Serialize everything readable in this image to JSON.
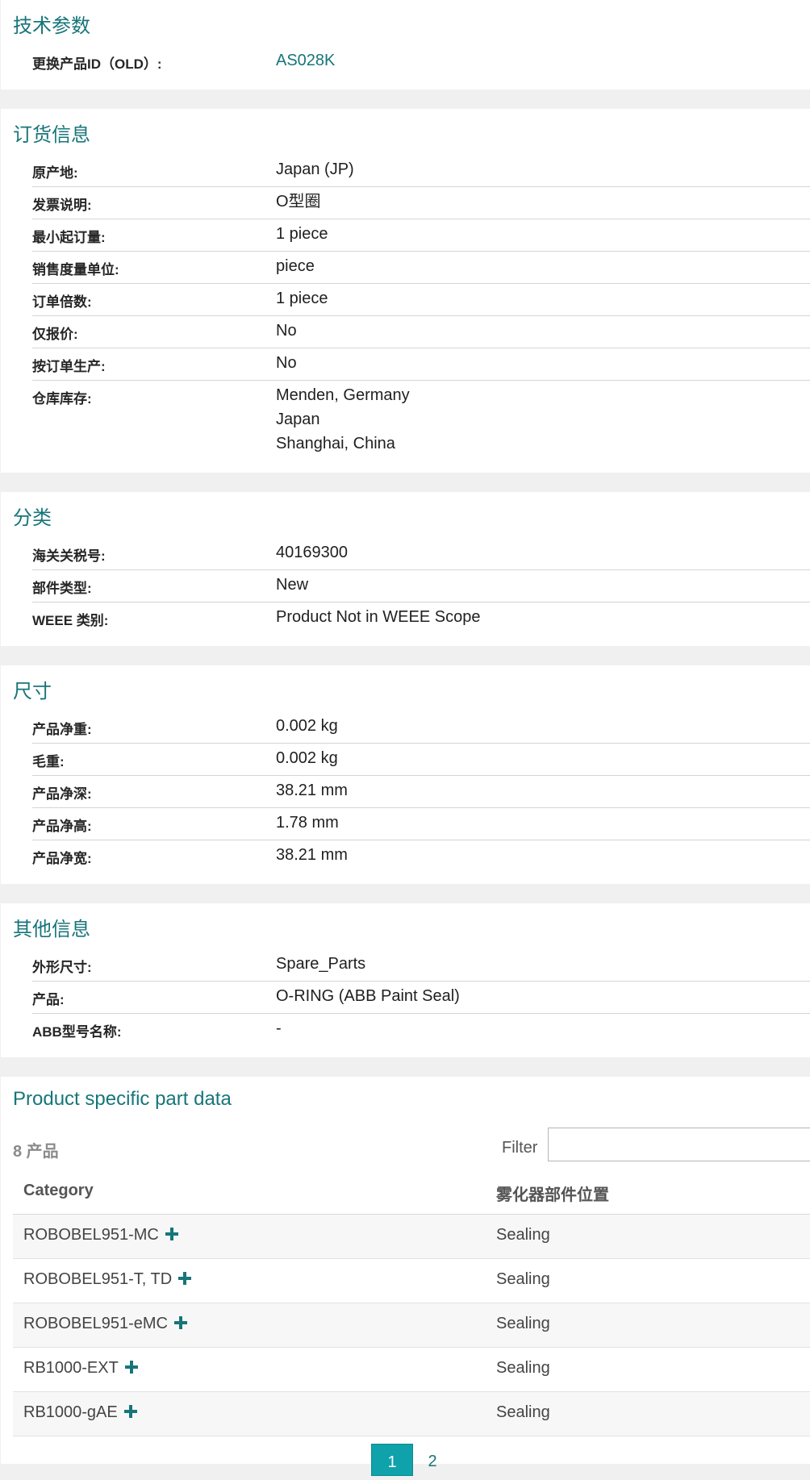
{
  "sections": {
    "tech": {
      "title": "技术参数",
      "rows": [
        {
          "label": "更换产品ID（OLD）:",
          "value": "AS028K"
        }
      ]
    },
    "order": {
      "title": "订货信息",
      "rows": [
        {
          "label": "原产地:",
          "value": "Japan (JP)"
        },
        {
          "label": "发票说明:",
          "value": "O型圈"
        },
        {
          "label": "最小起订量:",
          "value": "1 piece"
        },
        {
          "label": "销售度量单位:",
          "value": "piece"
        },
        {
          "label": "订单倍数:",
          "value": "1 piece"
        },
        {
          "label": "仅报价:",
          "value": "No"
        },
        {
          "label": "按订单生产:",
          "value": "No"
        },
        {
          "label": "仓库库存:",
          "values": [
            "Menden, Germany",
            "Japan",
            "Shanghai, China"
          ]
        }
      ]
    },
    "classification": {
      "title": "分类",
      "rows": [
        {
          "label": "海关关税号:",
          "value": "40169300"
        },
        {
          "label": "部件类型:",
          "value": "New"
        },
        {
          "label": "WEEE 类别:",
          "value": "Product Not in WEEE Scope"
        }
      ]
    },
    "dimensions": {
      "title": "尺寸",
      "rows": [
        {
          "label": "产品净重:",
          "value": "0.002 kg"
        },
        {
          "label": "毛重:",
          "value": "0.002 kg"
        },
        {
          "label": "产品净深:",
          "value": "38.21 mm"
        },
        {
          "label": "产品净高:",
          "value": "1.78 mm"
        },
        {
          "label": "产品净宽:",
          "value": "38.21 mm"
        }
      ]
    },
    "other": {
      "title": "其他信息",
      "rows": [
        {
          "label": "外形尺寸:",
          "value": "Spare_Parts"
        },
        {
          "label": "产品:",
          "value": "O-RING (ABB Paint Seal)"
        },
        {
          "label": "ABB型号名称:",
          "value": "-"
        }
      ]
    }
  },
  "part_data": {
    "title": "Product specific part data",
    "count_label": "8 产品",
    "filter_label": "Filter",
    "filter_value": "",
    "columns": [
      "Category",
      "雾化器部件位置"
    ],
    "rows": [
      {
        "category": "ROBOBEL951-MC",
        "position": "Sealing"
      },
      {
        "category": "ROBOBEL951-T, TD",
        "position": "Sealing"
      },
      {
        "category": "ROBOBEL951-eMC",
        "position": "Sealing"
      },
      {
        "category": "RB1000-EXT",
        "position": "Sealing"
      },
      {
        "category": "RB1000-gAE",
        "position": "Sealing"
      }
    ],
    "pagination": {
      "current": "1",
      "next": "2"
    }
  },
  "icons": {
    "expand": "plus-icon"
  },
  "colors": {
    "accent": "#17757a",
    "page_active": "#0fa2aa"
  }
}
